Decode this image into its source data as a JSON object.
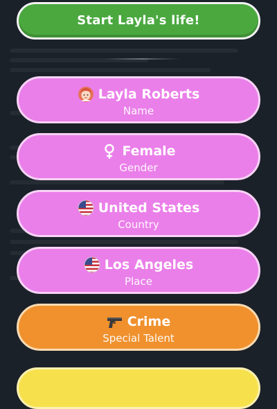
{
  "start_button": {
    "label": "Start Layla's life!"
  },
  "fields": [
    {
      "value": "Layla Roberts",
      "label": "Name",
      "icon": "woman-avatar-icon"
    },
    {
      "value": "Female",
      "label": "Gender",
      "icon": "female-symbol-icon"
    },
    {
      "value": "United States",
      "label": "Country",
      "icon": "us-flag-icon"
    },
    {
      "value": "Los Angeles",
      "label": "Place",
      "icon": "us-flag-icon"
    },
    {
      "value": "Crime",
      "label": "Special Talent",
      "icon": "pistol-icon"
    }
  ],
  "colors": {
    "start": "#4aa83f",
    "field": "#ea7fe9",
    "talent": "#f0912e",
    "next": "#f6e14d",
    "background": "#1b2129"
  }
}
